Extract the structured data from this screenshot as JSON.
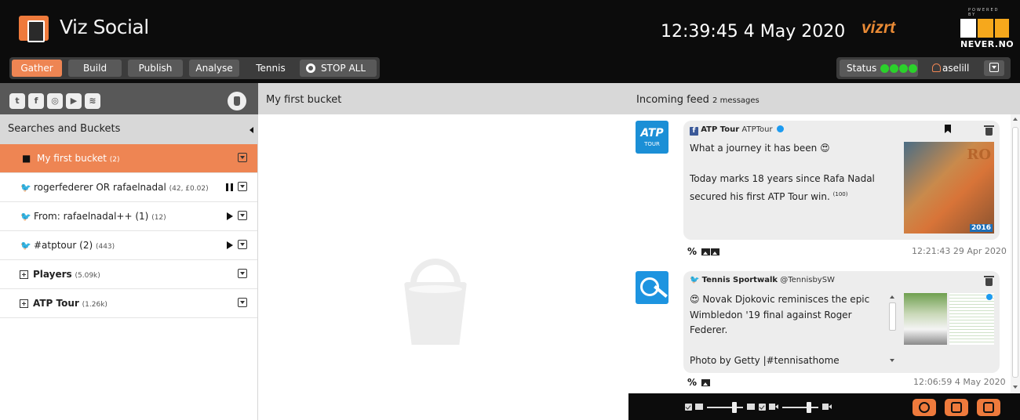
{
  "app": {
    "title": "Viz Social"
  },
  "header": {
    "clock": "12:39:45 4 May 2020",
    "vizrt": "vizrt",
    "powered_by": "POWERED BY",
    "never": "NEVER.NO"
  },
  "nav": {
    "tabs": [
      {
        "label": "Gather",
        "active": true
      },
      {
        "label": "Build",
        "active": false
      },
      {
        "label": "Publish",
        "active": false
      },
      {
        "label": "Analyse",
        "active": false
      },
      {
        "label": "Tennis",
        "active": false
      }
    ],
    "stop_all": "STOP ALL"
  },
  "status": {
    "label": "Status",
    "indicator_color": "#2bd12b",
    "user": "aselill"
  },
  "left": {
    "social_icons": [
      "twitter-icon",
      "facebook-icon",
      "instagram-icon",
      "youtube-icon",
      "rss-icon"
    ],
    "section_title": "Searches and Buckets",
    "items": [
      {
        "label": "My first bucket",
        "sub": "(2)",
        "icon": "bucket-icon",
        "state": ""
      },
      {
        "label": "rogerfederer OR rafaelnadal",
        "sub": "(42, £0.02)",
        "icon": "twitter-icon",
        "state": "paused"
      },
      {
        "label": "From: rafaelnadal++ (1)",
        "sub": "(12)",
        "icon": "twitter-icon",
        "state": "play"
      },
      {
        "label": "#atptour (2)",
        "sub": "(443)",
        "icon": "twitter-icon",
        "state": "play"
      },
      {
        "label": "Players",
        "sub": "(5.09k)",
        "icon": "expand-icon",
        "state": ""
      },
      {
        "label": "ATP Tour",
        "sub": "(1.26k)",
        "icon": "expand-icon",
        "state": ""
      }
    ]
  },
  "center": {
    "title": "My first bucket"
  },
  "feed": {
    "title": "Incoming feed",
    "count": "2 messages",
    "posts": [
      {
        "network": "facebook",
        "author": "ATP Tour",
        "handle": "ATPTour",
        "text": "What a journey it has been 😍\n\nToday marks 18 years since Rafa Nadal secured his first ATP Tour win.",
        "superscript": "(100)",
        "photo_label": "2016",
        "photo_text": "RO",
        "timestamp": "12:21:43 29 Apr 2020"
      },
      {
        "network": "twitter",
        "author": "Tennis Sportwalk",
        "handle": "@TennisbySW",
        "text": "😍 Novak Djokovic reminisces the epic Wimbledon '19 final against Roger Federer.\n\nPhoto by Getty |#tennisathome #stayhome #novakdjokovic #djokovic #nolefam",
        "timestamp": "12:06:59 4 May 2020"
      }
    ]
  },
  "avatar1": {
    "text": "ATP",
    "sub": "TOUR"
  }
}
